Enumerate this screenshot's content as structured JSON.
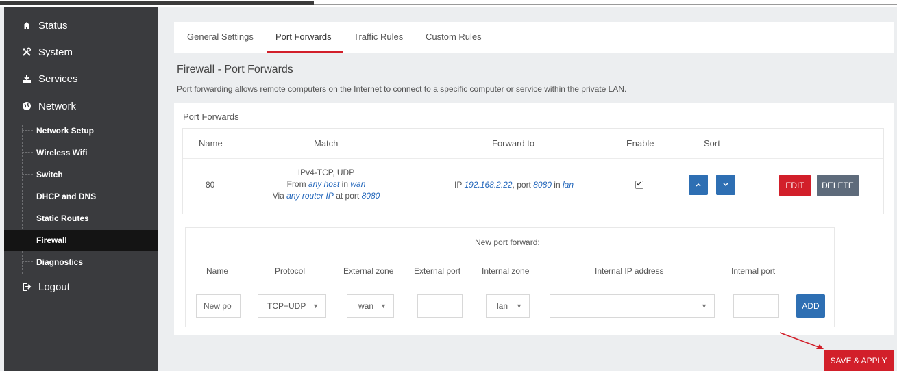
{
  "sidebar": {
    "items": [
      {
        "label": "Status",
        "icon": "home-icon"
      },
      {
        "label": "System",
        "icon": "tools-icon"
      },
      {
        "label": "Services",
        "icon": "download-icon"
      },
      {
        "label": "Network",
        "icon": "globe-icon"
      }
    ],
    "network_sub": [
      {
        "label": "Network Setup"
      },
      {
        "label": "Wireless Wifi"
      },
      {
        "label": "Switch"
      },
      {
        "label": "DHCP and DNS"
      },
      {
        "label": "Static Routes"
      },
      {
        "label": "Firewall",
        "active": true
      },
      {
        "label": "Diagnostics"
      }
    ],
    "logout": {
      "label": "Logout",
      "icon": "logout-icon"
    }
  },
  "tabs": [
    {
      "label": "General Settings"
    },
    {
      "label": "Port Forwards",
      "active": true
    },
    {
      "label": "Traffic Rules"
    },
    {
      "label": "Custom Rules"
    }
  ],
  "page": {
    "title": "Firewall - Port Forwards",
    "description": "Port forwarding allows remote computers on the Internet to connect to a specific computer or service within the private LAN."
  },
  "port_forwards": {
    "title": "Port Forwards",
    "headers": {
      "name": "Name",
      "match": "Match",
      "forward_to": "Forward to",
      "enable": "Enable",
      "sort": "Sort"
    },
    "rows": [
      {
        "name": "80",
        "match_line1": "IPv4-TCP, UDP",
        "match_from_prefix": "From",
        "match_from_host": "any host",
        "match_from_in": "in",
        "match_from_zone": "wan",
        "match_via_prefix": "Via",
        "match_via_router": "any router IP",
        "match_via_at": "at port",
        "match_via_port": "8080",
        "fwd_ip_prefix": "IP",
        "fwd_ip": "192.168.2.22",
        "fwd_port_prefix": ", port",
        "fwd_port": "8080",
        "fwd_in": "in",
        "fwd_zone": "lan",
        "enabled": true,
        "edit_label": "EDIT",
        "delete_label": "DELETE"
      }
    ]
  },
  "new_forward": {
    "title": "New port forward:",
    "headers": {
      "name": "Name",
      "protocol": "Protocol",
      "external_zone": "External zone",
      "external_port": "External port",
      "internal_zone": "Internal zone",
      "internal_ip": "Internal IP address",
      "internal_port": "Internal port"
    },
    "name_placeholder": "New po",
    "protocol": "TCP+UDP",
    "external_zone": "wan",
    "internal_zone": "lan",
    "internal_ip": "",
    "add_label": "ADD"
  },
  "save_apply_label": "SAVE & APPLY",
  "colors": {
    "sidebar_bg": "#3a3b3e",
    "accent_red": "#d21f2a",
    "primary_blue": "#2e6fb3",
    "delete_gray": "#5e6b7b"
  }
}
